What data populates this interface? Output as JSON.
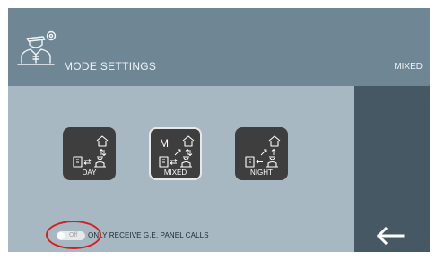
{
  "header": {
    "title": "MODE SETTINGS",
    "current_mode": "MIXED",
    "icon": "concierge-settings-icon"
  },
  "modes": [
    {
      "label": "DAY",
      "icon": "day-mode-icon",
      "selected": false
    },
    {
      "label": "MIXED",
      "icon": "mixed-mode-icon",
      "selected": true,
      "badge": "M"
    },
    {
      "label": "NIGHT",
      "icon": "night-mode-icon",
      "selected": false
    }
  ],
  "toggle": {
    "state_text": "Off",
    "checked": false,
    "label": "ONLY RECEIVE G.E. PANEL CALLS"
  },
  "navigation": {
    "back_icon": "back-arrow-icon"
  },
  "colors": {
    "header_bg": "#6f8795",
    "content_bg": "#a8b8c3",
    "side_panel_bg": "#455864",
    "button_bg": "#3e3e3e",
    "annotation": "#d81e1e"
  }
}
